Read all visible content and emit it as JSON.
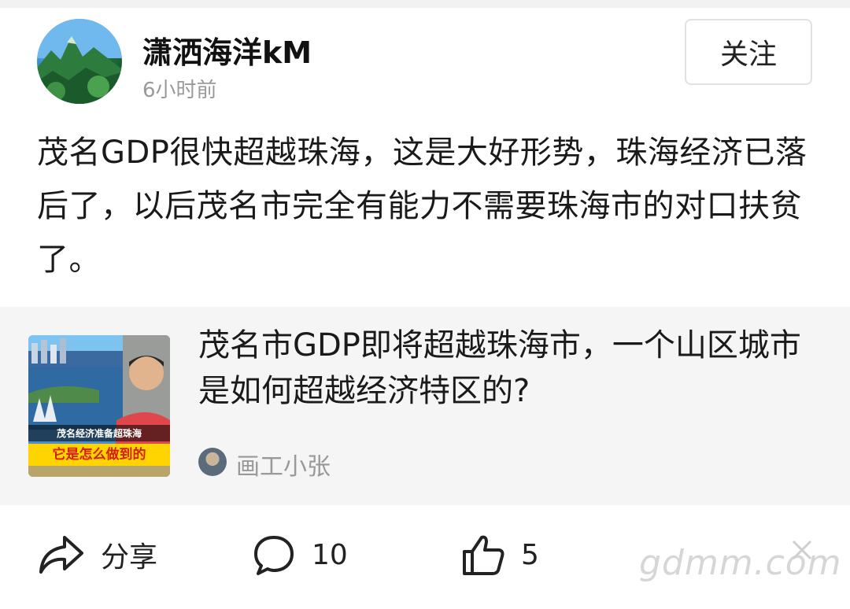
{
  "post": {
    "author": "潇洒海洋kM",
    "time": "6小时前",
    "follow_label": "关注",
    "body": "茂名GDP很快超越珠海，这是大好形势，珠海经济已落后了，以后茂名市完全有能力不需要珠海市的对口扶贫了。"
  },
  "shared": {
    "title": "茂名市GDP即将超越珠海市，一个山区城市是如何超越经济特区的?",
    "author": "画工小张",
    "thumb_caption_1": "茂名经济准备超珠海",
    "thumb_caption_2": "它是怎么做到的"
  },
  "actions": {
    "share_label": "分享",
    "comment_count": "10",
    "like_count": "5"
  },
  "watermark": "gdmm.com",
  "icons": {
    "share": "share-arrow-icon",
    "comment": "comment-bubble-icon",
    "like": "thumbs-up-icon"
  }
}
